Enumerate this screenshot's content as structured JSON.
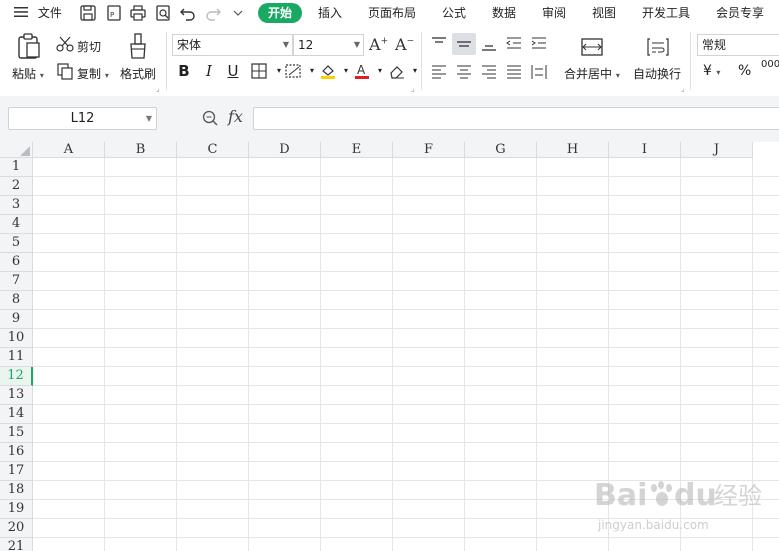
{
  "menu": {
    "file_label": "文件",
    "tabs": [
      "开始",
      "插入",
      "页面布局",
      "公式",
      "数据",
      "审阅",
      "视图",
      "开发工具",
      "会员专享"
    ]
  },
  "ribbon": {
    "paste": "粘贴",
    "cut": "剪切",
    "copy": "复制",
    "format_painter": "格式刷",
    "font_name": "宋体",
    "font_size": "12",
    "merge_center": "合并居中",
    "wrap_text": "自动换行",
    "number_format": "常规",
    "currency_symbol": "¥",
    "percent_symbol": "%",
    "thousands_symbol": "000"
  },
  "formula_bar": {
    "name_box": "L12",
    "fx": "fx",
    "formula": ""
  },
  "grid": {
    "columns": [
      "A",
      "B",
      "C",
      "D",
      "E",
      "F",
      "G",
      "H",
      "I",
      "J"
    ],
    "rows": [
      "1",
      "2",
      "3",
      "4",
      "5",
      "6",
      "7",
      "8",
      "9",
      "10",
      "11",
      "12",
      "13",
      "14",
      "15",
      "16",
      "17",
      "18",
      "19",
      "20",
      "21"
    ],
    "active_row": "12"
  },
  "watermark": {
    "brand": "Bai",
    "brand2": "du",
    "tagline": "经验",
    "url": "jingyan.baidu.com"
  },
  "colors": {
    "accent": "#1aa865",
    "grid_line": "#e3e6e9",
    "header_bg": "#f3f4f6"
  }
}
